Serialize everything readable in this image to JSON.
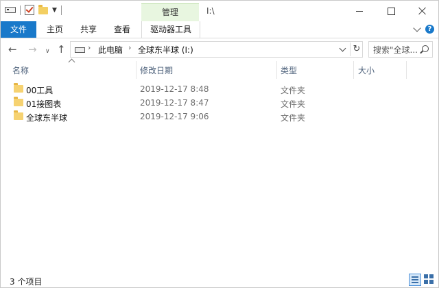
{
  "title_bar": {
    "context_tab_group": "管理",
    "path": "I:\\"
  },
  "ribbon": {
    "tabs": [
      "文件",
      "主页",
      "共享",
      "查看",
      "驱动器工具"
    ]
  },
  "address_bar": {
    "crumbs": [
      "此电脑",
      "全球东半球 (I:)"
    ],
    "search_placeholder": "搜索\"全球..."
  },
  "columns": [
    "名称",
    "修改日期",
    "类型",
    "大小"
  ],
  "files": [
    {
      "name": "00工具",
      "date": "2019-12-17 8:48",
      "type": "文件夹"
    },
    {
      "name": "01接图表",
      "date": "2019-12-17 8:47",
      "type": "文件夹"
    },
    {
      "name": "全球东半球",
      "date": "2019-12-17 9:06",
      "type": "文件夹"
    }
  ],
  "status": {
    "item_count": "3 个项目"
  },
  "colors": {
    "accent": "#1979ca",
    "context_tab": "#e8f6e0",
    "folder": "#f6d271"
  },
  "icons": [
    "drive-icon",
    "properties-icon",
    "new-folder-icon",
    "back-icon",
    "forward-icon",
    "up-icon",
    "refresh-icon",
    "search-icon",
    "folder-icon",
    "details-view-icon",
    "large-icons-view-icon"
  ]
}
